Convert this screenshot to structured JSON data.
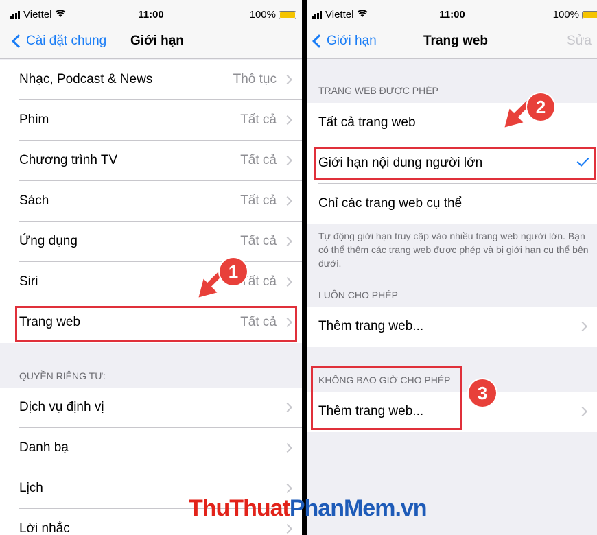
{
  "left": {
    "status": {
      "carrier": "Viettel",
      "time": "11:00",
      "battery": "100%"
    },
    "nav": {
      "back": "Cài đặt chung",
      "title": "Giới hạn"
    },
    "rows": [
      {
        "label": "Nhạc, Podcast & News",
        "value": "Thô tục"
      },
      {
        "label": "Phim",
        "value": "Tất cả"
      },
      {
        "label": "Chương trình TV",
        "value": "Tất cả"
      },
      {
        "label": "Sách",
        "value": "Tất cả"
      },
      {
        "label": "Ứng dụng",
        "value": "Tất cả"
      },
      {
        "label": "Siri",
        "value": "Tất cả"
      },
      {
        "label": "Trang web",
        "value": "Tất cả"
      }
    ],
    "privacy_header": "QUYỀN RIÊNG TƯ:",
    "privacy_rows": [
      {
        "label": "Dịch vụ định vị"
      },
      {
        "label": "Danh bạ"
      },
      {
        "label": "Lịch"
      },
      {
        "label": "Lời nhắc"
      }
    ]
  },
  "right": {
    "status": {
      "carrier": "Viettel",
      "time": "11:00",
      "battery": "100%"
    },
    "nav": {
      "back": "Giới hạn",
      "title": "Trang web",
      "edit": "Sửa"
    },
    "allowed_header": "TRANG WEB ĐƯỢC PHÉP",
    "options": [
      {
        "label": "Tất cả trang web",
        "selected": false
      },
      {
        "label": "Giới hạn nội dung người lớn",
        "selected": true
      },
      {
        "label": "Chỉ các trang web cụ thể",
        "selected": false
      }
    ],
    "footer": "Tự động giới hạn truy cập vào nhiều trang web người lớn. Bạn có thể thêm các trang web được phép và bị giới hạn cụ thể bên dưới.",
    "always_header": "LUÔN CHO PHÉP",
    "always_add": "Thêm trang web...",
    "never_header": "KHÔNG BAO GIỜ CHO PHÉP",
    "never_add": "Thêm trang web..."
  },
  "annotations": {
    "badge1": "1",
    "badge2": "2",
    "badge3": "3",
    "color": "#e8403a"
  },
  "watermark": {
    "part1": "ThuThuat",
    "part2": "PhanMem",
    "part3": ".vn"
  },
  "colors": {
    "accent": "#1a7df6",
    "highlight": "#e0303a",
    "watermark_red": "#e2231a",
    "watermark_blue": "#1e5bb8"
  }
}
